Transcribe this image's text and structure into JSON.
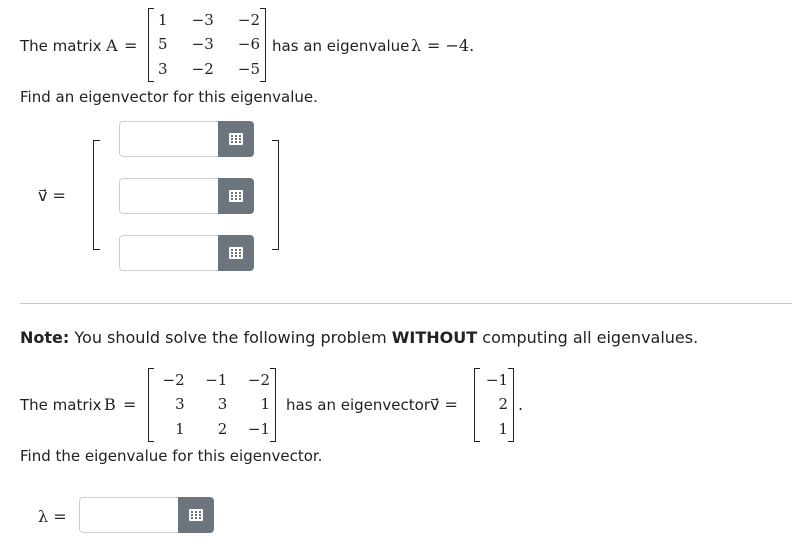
{
  "problem1": {
    "intro": "The matrix",
    "matrix_name": "A",
    "equals": "=",
    "matrix": [
      [
        "1",
        "−3",
        "−2"
      ],
      [
        "5",
        "−3",
        "−6"
      ],
      [
        "3",
        "−2",
        "−5"
      ]
    ],
    "after": "has an eigenvalue",
    "lambda_symbol": "λ",
    "lambda_value": "= −4.",
    "instruction": "Find an eigenvector for this eigenvalue.",
    "vector_label": "v⃗ =",
    "inputs": [
      "",
      "",
      ""
    ]
  },
  "note": {
    "prefix": "Note:",
    "text1": "You should solve the following problem",
    "emph": "WITHOUT",
    "text2": "computing all eigenvalues."
  },
  "problem2": {
    "intro": "The matrix",
    "matrix_name": "B",
    "equals": "=",
    "matrix": [
      [
        "−2",
        "−1",
        "−2"
      ],
      [
        "3",
        "3",
        "1"
      ],
      [
        "1",
        "2",
        "−1"
      ]
    ],
    "after": "has an eigenvector",
    "vector_symbol": "v⃗ =",
    "vector": [
      [
        "−1"
      ],
      [
        "2"
      ],
      [
        "1"
      ]
    ],
    "period": ".",
    "instruction": "Find the eigenvalue for this eigenvector.",
    "lambda_label": "λ =",
    "input": ""
  }
}
